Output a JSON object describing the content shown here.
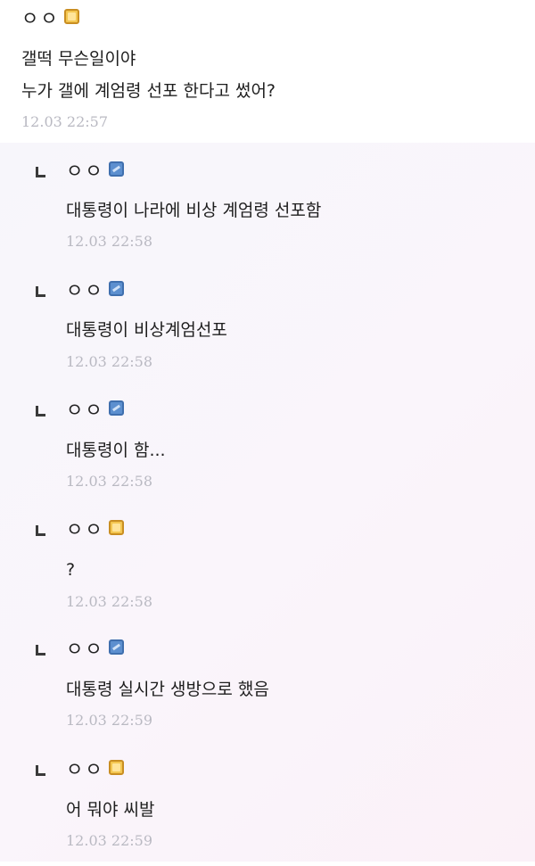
{
  "comment": {
    "nickname": "ㅇㅇ",
    "badge": "gold",
    "lines": [
      "갤떡 무슨일이야",
      "누가 갤에 계엄령 선포 한다고 썼어?"
    ],
    "time": "12.03 22:57"
  },
  "replies": [
    {
      "nickname": "ㅇㅇ",
      "badge": "blue",
      "text": "대통령이 나라에 비상 계엄령 선포함",
      "time": "12.03 22:58"
    },
    {
      "nickname": "ㅇㅇ",
      "badge": "blue",
      "text": "대통령이 비상계엄선포",
      "time": "12.03 22:58"
    },
    {
      "nickname": "ㅇㅇ",
      "badge": "blue",
      "text": "대통령이 함...",
      "time": "12.03 22:58"
    },
    {
      "nickname": "ㅇㅇ",
      "badge": "gold",
      "text": "?",
      "time": "12.03 22:58"
    },
    {
      "nickname": "ㅇㅇ",
      "badge": "blue",
      "text": "대통령 실시간 생방으로 했음",
      "time": "12.03 22:59"
    },
    {
      "nickname": "ㅇㅇ",
      "badge": "gold",
      "text": "어 뭐야 씨발",
      "time": "12.03 22:59"
    }
  ]
}
